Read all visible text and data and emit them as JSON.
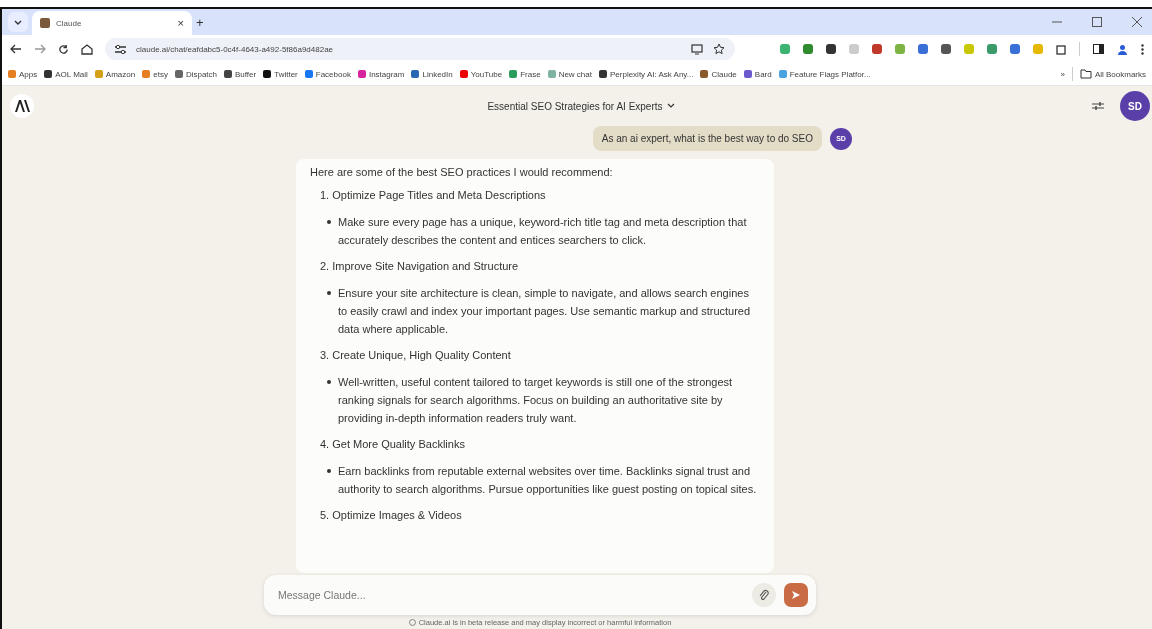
{
  "browser": {
    "tab": {
      "title": "Claude",
      "close": "×"
    },
    "new_tab": "+",
    "url": "claude.ai/chat/eafdabc5-0c4f-4643-a492-5f86a9d482ae",
    "bookmarks": [
      {
        "label": "Apps"
      },
      {
        "label": "AOL Mail"
      },
      {
        "label": "Amazon"
      },
      {
        "label": "etsy"
      },
      {
        "label": "Dispatch"
      },
      {
        "label": "Buffer"
      },
      {
        "label": "Twitter"
      },
      {
        "label": "Facebook"
      },
      {
        "label": "Instagram"
      },
      {
        "label": "LinkedIn"
      },
      {
        "label": "YouTube"
      },
      {
        "label": "Frase"
      },
      {
        "label": "New chat"
      },
      {
        "label": "Perplexity AI: Ask Any..."
      },
      {
        "label": "Claude"
      },
      {
        "label": "Bard"
      },
      {
        "label": "Feature Flags Platfor..."
      }
    ],
    "more_bookmarks": "»",
    "all_bookmarks": "All Bookmarks"
  },
  "chat": {
    "title": "Essential SEO Strategies for AI Experts",
    "user_initials": "SD",
    "user_message": {
      "text": "As an ai expert, what is the best way to do SEO",
      "initials": "SD"
    },
    "reply": {
      "intro": "Here are some of the best SEO practices I would recommend:",
      "items": [
        {
          "kind": "numbered",
          "text": "1. Optimize Page Titles and Meta Descriptions"
        },
        {
          "kind": "bullet",
          "text": "Make sure every page has a unique, keyword-rich title tag and meta description that accurately describes the content and entices searchers to click."
        },
        {
          "kind": "numbered",
          "text": "2. Improve Site Navigation and Structure"
        },
        {
          "kind": "bullet",
          "text": "Ensure your site architecture is clean, simple to navigate, and allows search engines to easily crawl and index your important pages. Use semantic markup and structured data where applicable."
        },
        {
          "kind": "numbered",
          "text": "3. Create Unique, High Quality Content"
        },
        {
          "kind": "bullet",
          "text": "Well-written, useful content tailored to target keywords is still one of the strongest ranking signals for search algorithms. Focus on building an authoritative site by providing in-depth information readers truly want."
        },
        {
          "kind": "numbered",
          "text": "4. Get More Quality Backlinks"
        },
        {
          "kind": "bullet",
          "text": "Earn backlinks from reputable external websites over time. Backlinks signal trust and authority to search algorithms. Pursue opportunities like guest posting on topical sites."
        },
        {
          "kind": "numbered",
          "text": "5. Optimize Images & Videos"
        }
      ]
    },
    "input": {
      "placeholder": "Message Claude..."
    },
    "footer": "Claude.ai is in beta release and may display incorrect or harmful information"
  }
}
